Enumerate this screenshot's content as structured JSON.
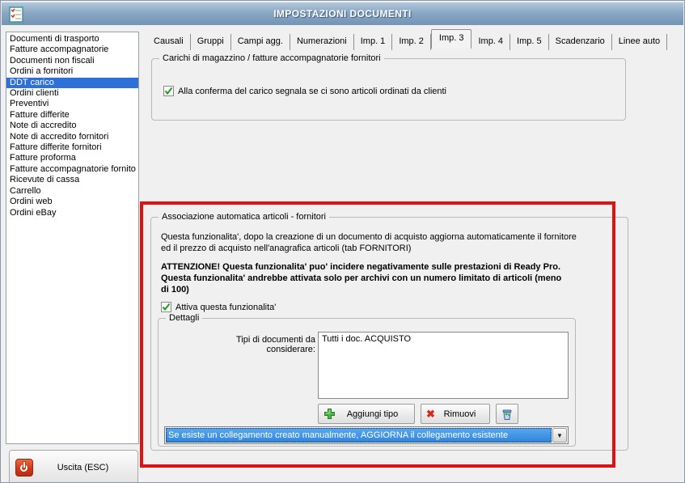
{
  "window": {
    "title": "IMPOSTAZIONI DOCUMENTI"
  },
  "sidebar": {
    "items": [
      "Documenti di trasporto",
      "Fatture accompagnatorie",
      "Documenti non fiscali",
      "Ordini a fornitori",
      "DDT carico",
      "Ordini clienti",
      "Preventivi",
      "Fatture differite",
      "Note di accredito",
      "Note di accredito fornitori",
      "Fatture differite fornitori",
      "Fatture proforma",
      "Fatture accompagnatorie fornito",
      "Ricevute di cassa",
      "Carrello",
      "Ordini web",
      "Ordini eBay"
    ],
    "selected_item": "DDT carico",
    "exit_button_label": "Uscita (ESC)"
  },
  "tabs": [
    "Causali",
    "Gruppi",
    "Campi agg.",
    "Numerazioni",
    "Imp. 1",
    "Imp. 2",
    "Imp. 3",
    "Imp. 4",
    "Imp. 5",
    "Scadenzario",
    "Linee auto"
  ],
  "selected_tab": "Imp. 3",
  "panel_carichi": {
    "title": "Carichi di magazzino / fatture accompagnatorie fornitori",
    "checkbox_label": "Alla conferma del carico segnala se ci sono articoli ordinati da clienti",
    "checkbox_checked": true
  },
  "panel_associazione": {
    "title": "Associazione automatica articoli - fornitori",
    "description": "Questa funzionalita', dopo la creazione di un documento di acquisto aggiorna automaticamente il fornitore ed il prezzo di acquisto nell'anagrafica articoli (tab FORNITORI)",
    "warning": "ATTENZIONE! Questa funzionalita' puo' incidere negativamente sulle prestazioni di Ready Pro. Questa funzionalita' andrebbe attivata solo per archivi con un numero limitato di articoli (meno di 100)",
    "activate_checkbox_label": "Attiva questa funzionalita'",
    "activate_checkbox_checked": true,
    "details": {
      "title": "Dettagli",
      "doc_types_label": "Tipi di documenti da considerare:",
      "doc_types": [
        "Tutti i doc. ACQUISTO"
      ],
      "add_button_label": "Aggiungi tipo",
      "remove_button_label": "Rimuovi",
      "dropdown_value": "Se esiste un collegamento creato manualmente, AGGIORNA il collegamento esistente"
    }
  },
  "colors": {
    "titlebar_top": "#b2c7da",
    "titlebar_bottom": "#7494b6",
    "sidebar_selection": "#2e6fd8",
    "combo_selection": "#3e94e4",
    "annotation_red": "#dc1312",
    "window_bg": "#f0f0f0",
    "check_green": "#18a018",
    "plus_green": "#4db848",
    "remove_red": "#d8291a"
  }
}
